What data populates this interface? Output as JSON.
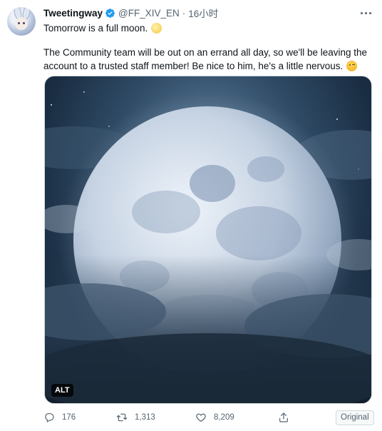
{
  "tweet": {
    "author_name": "Tweetingway",
    "handle": "@FF_XIV_EN",
    "separator": "·",
    "time": "16小时",
    "line1": "Tomorrow is a full moon.",
    "line2": "The Community team will be out on an errand all day, so we'll be leaving the",
    "line3": "account to a trusted staff member! Be nice to him, he's a little nervous.",
    "alt_badge": "ALT"
  },
  "icons": {
    "verified": "verified-badge-icon",
    "more": "more-options-icon",
    "reply": "reply-icon",
    "retweet": "retweet-icon",
    "like": "heart-icon",
    "share": "share-icon"
  },
  "stats": {
    "replies": "176",
    "retweets": "1,313",
    "likes": "8,209"
  },
  "original_button": "Original",
  "colors": {
    "verified": "#1d9bf0",
    "muted": "#536471",
    "text": "#0f1419"
  }
}
